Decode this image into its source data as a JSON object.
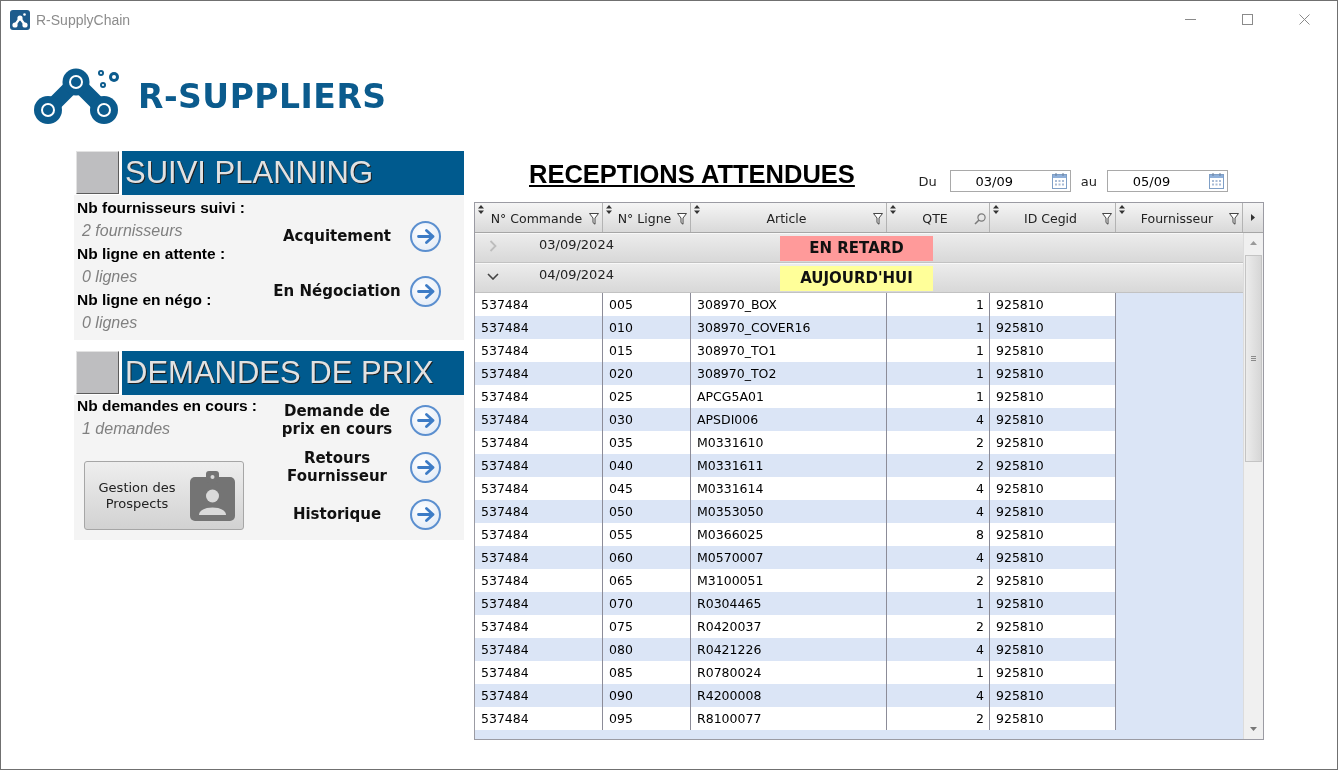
{
  "window": {
    "title": "R-SupplyChain"
  },
  "logo": {
    "text": "R-SUPPLIERS"
  },
  "sections": [
    {
      "title": "SUIVI PLANNING",
      "stats": [
        {
          "label": "Nb fournisseurs suivi :",
          "value": "2 fournisseurs"
        },
        {
          "label": "Nb ligne en attente :",
          "value": "0 lignes"
        },
        {
          "label": "Nb ligne en négo :",
          "value": "0 lignes"
        }
      ],
      "links": [
        {
          "label": "Acquitement"
        },
        {
          "label": "En Négociation"
        }
      ]
    },
    {
      "title": "DEMANDES DE PRIX",
      "stats": [
        {
          "label": "Nb demandes en cours :",
          "value": "1 demandes"
        }
      ],
      "button": {
        "label": "Gestion des Prospects"
      },
      "links": [
        {
          "label": "Demande de prix en cours"
        },
        {
          "label": "Retours Fournisseur"
        },
        {
          "label": "Historique"
        }
      ]
    }
  ],
  "receptions": {
    "title": "RECEPTIONS ATTENDUES",
    "date_from": {
      "label": "Du",
      "value": "03/09"
    },
    "date_to": {
      "label": "au",
      "value": "05/09"
    },
    "table": {
      "columns": [
        {
          "label": "N° Commande",
          "kind": "filter",
          "selected": false
        },
        {
          "label": "N° Ligne",
          "kind": "filter",
          "selected": false
        },
        {
          "label": "Article",
          "kind": "filter",
          "selected": false
        },
        {
          "label": "QTE",
          "kind": "search",
          "selected": false
        },
        {
          "label": "ID Cegid",
          "kind": "filter",
          "selected": false
        },
        {
          "label": "Fournisseur",
          "kind": "filter",
          "selected": true
        }
      ],
      "groups": [
        {
          "date": "03/09/2024",
          "badge": "EN RETARD",
          "color": "#ff9a9a",
          "expanded": false
        },
        {
          "date": "04/09/2024",
          "badge": "AUJOURD'HUI",
          "color": "#ffff99",
          "expanded": true,
          "rows": [
            [
              "537484",
              "005",
              "308970_BOX",
              "1",
              "925810"
            ],
            [
              "537484",
              "010",
              "308970_COVER16",
              "1",
              "925810"
            ],
            [
              "537484",
              "015",
              "308970_TO1",
              "1",
              "925810"
            ],
            [
              "537484",
              "020",
              "308970_TO2",
              "1",
              "925810"
            ],
            [
              "537484",
              "025",
              "APCG5A01",
              "1",
              "925810"
            ],
            [
              "537484",
              "030",
              "APSDI006",
              "4",
              "925810"
            ],
            [
              "537484",
              "035",
              "M0331610",
              "2",
              "925810"
            ],
            [
              "537484",
              "040",
              "M0331611",
              "2",
              "925810"
            ],
            [
              "537484",
              "045",
              "M0331614",
              "4",
              "925810"
            ],
            [
              "537484",
              "050",
              "M0353050",
              "4",
              "925810"
            ],
            [
              "537484",
              "055",
              "M0366025",
              "8",
              "925810"
            ],
            [
              "537484",
              "060",
              "M0570007",
              "4",
              "925810"
            ],
            [
              "537484",
              "065",
              "M3100051",
              "2",
              "925810"
            ],
            [
              "537484",
              "070",
              "R0304465",
              "1",
              "925810"
            ],
            [
              "537484",
              "075",
              "R0420037",
              "2",
              "925810"
            ],
            [
              "537484",
              "080",
              "R0421226",
              "4",
              "925810"
            ],
            [
              "537484",
              "085",
              "R0780024",
              "1",
              "925810"
            ],
            [
              "537484",
              "090",
              "R4200008",
              "4",
              "925810"
            ],
            [
              "537484",
              "095",
              "R8100077",
              "2",
              "925810"
            ]
          ]
        }
      ]
    }
  }
}
